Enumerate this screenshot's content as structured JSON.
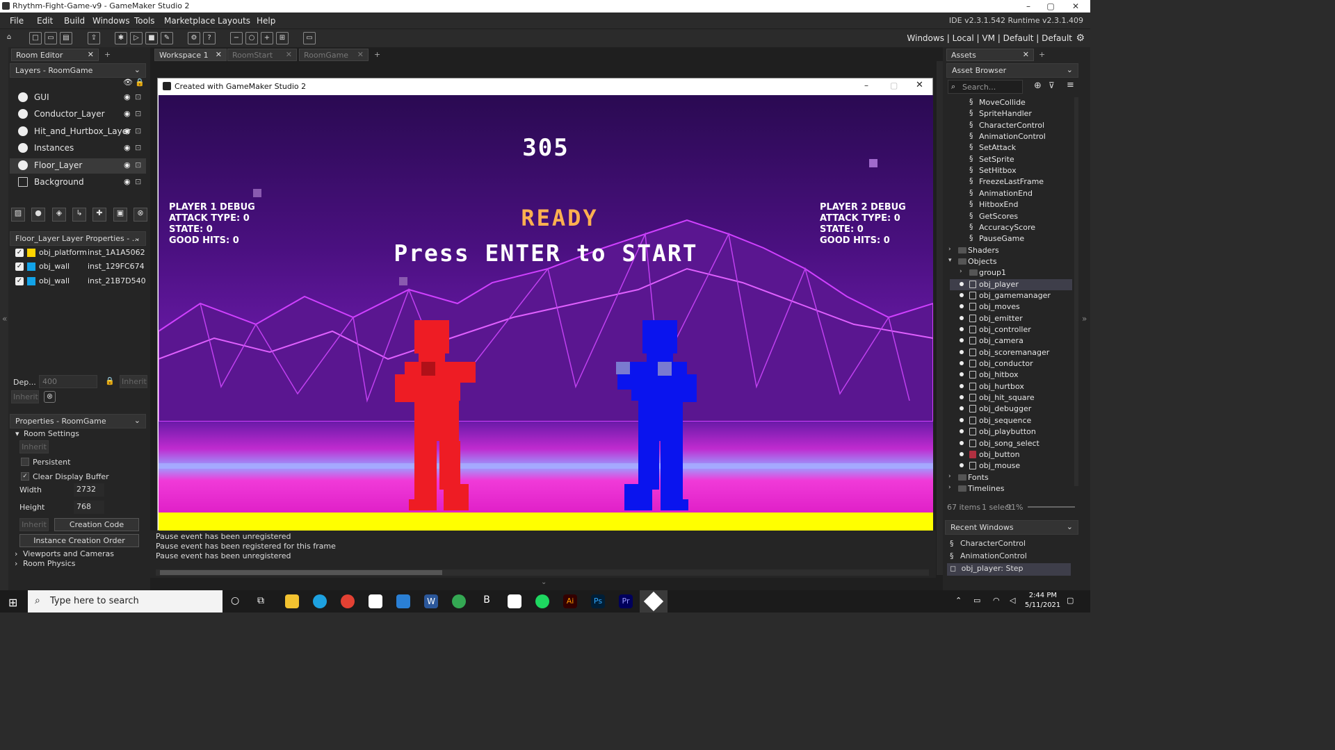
{
  "window": {
    "title": "Rhythm-Fight-Game-v9 - GameMaker Studio 2"
  },
  "menu": [
    "File",
    "Edit",
    "Build",
    "Windows",
    "Tools",
    "Marketplace",
    "Layouts",
    "Help"
  ],
  "version": "IDE v2.3.1.542  Runtime v2.3.1.409",
  "targets": "Windows | Local | VM | Default | Default",
  "room_editor": {
    "tab": "Room Editor",
    "layers_header": "Layers - RoomGame",
    "layers": [
      "GUI",
      "Conductor_Layer",
      "Hit_and_Hurtbox_Layer",
      "Instances",
      "Floor_Layer",
      "Background"
    ],
    "layer_props_header": "Floor_Layer Layer Properties - ...",
    "instances": [
      {
        "obj": "obj_platform",
        "inst": "inst_1A1A5062",
        "color": "#ffd400"
      },
      {
        "obj": "obj_wall",
        "inst": "inst_129FC674",
        "color": "#12a3e8"
      },
      {
        "obj": "obj_wall",
        "inst": "inst_21B7D540",
        "color": "#12a3e8"
      }
    ],
    "depth_label": "Dep...",
    "depth_value": "400",
    "inherit": "Inherit",
    "props_header": "Properties - RoomGame",
    "room_settings": "Room Settings",
    "persistent": "Persistent",
    "clear_display": "Clear Display Buffer",
    "width_label": "Width",
    "width_value": "2732",
    "height_label": "Height",
    "height_value": "768",
    "creation_code": "Creation Code",
    "instance_order": "Instance Creation Order",
    "viewports": "Viewports and Cameras",
    "physics": "Room Physics"
  },
  "workspace_tabs": [
    "Workspace 1",
    "RoomStart",
    "RoomGame"
  ],
  "game": {
    "window_title": "Created with GameMaker Studio 2",
    "score": "305",
    "ready": "READY",
    "press": "Press ENTER to START",
    "p1": [
      "PLAYER 1 DEBUG",
      "ATTACK TYPE: 0",
      "STATE: 0",
      "GOOD HITS: 0"
    ],
    "p2": [
      "PLAYER 2 DEBUG",
      "ATTACK TYPE: 0",
      "STATE: 0",
      "GOOD HITS: 0"
    ]
  },
  "console": [
    "Pause event has been unregistered",
    "Pause event has been registered for this frame",
    "Pause event has been unregistered"
  ],
  "assets": {
    "tab": "Assets",
    "browser": "Asset Browser",
    "search_placeholder": "Search...",
    "scripts": [
      "MoveCollide",
      "SpriteHandler",
      "CharacterControl",
      "AnimationControl",
      "SetAttack",
      "SetSprite",
      "SetHitbox",
      "FreezeLastFrame",
      "AnimationEnd",
      "HitboxEnd",
      "GetScores",
      "AccuracyScore",
      "PauseGame"
    ],
    "shaders": "Shaders",
    "objects": "Objects",
    "group": "group1",
    "object_list": [
      "obj_player",
      "obj_gamemanager",
      "obj_moves",
      "obj_emitter",
      "obj_controller",
      "obj_camera",
      "obj_scoremanager",
      "obj_conductor",
      "obj_hitbox",
      "obj_hurtbox",
      "obj_hit_square",
      "obj_debugger",
      "obj_sequence",
      "obj_playbutton",
      "obj_song_select",
      "obj_button",
      "obj_mouse"
    ],
    "fonts": "Fonts",
    "timelines": "Timelines",
    "status": "67 items",
    "status2": "1 select",
    "zoom": "91%",
    "recent_header": "Recent Windows",
    "recent": [
      "CharacterControl",
      "AnimationControl",
      "obj_player: Step"
    ]
  },
  "taskbar": {
    "search": "Type here to search",
    "time": "2:44 PM",
    "date": "5/11/2021"
  }
}
